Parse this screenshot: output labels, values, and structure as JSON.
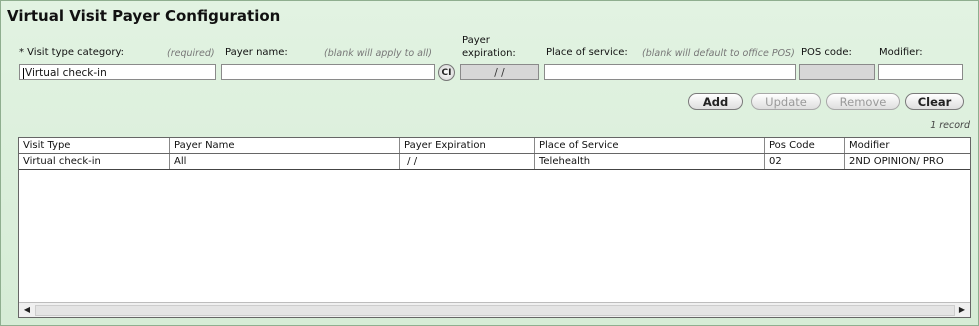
{
  "title": "Virtual Visit Payer Configuration",
  "form": {
    "visit_type_label": "* Visit type category:",
    "visit_type_hint": "(required)",
    "visit_type_value": "Virtual check-in",
    "payer_name_label": "Payer name:",
    "payer_name_hint": "(blank will apply to all)",
    "payer_name_value": "",
    "ci_label": "CI",
    "payer_expiration_label_line1": "Payer",
    "payer_expiration_label_line2": "expiration:",
    "payer_expiration_value": "/ /",
    "place_of_service_label": "Place of service:",
    "place_of_service_hint": "(blank will default to office POS)",
    "place_of_service_value": "",
    "pos_code_label": "POS code:",
    "pos_code_value": "",
    "modifier_label": "Modifier:",
    "modifier_value": ""
  },
  "buttons": {
    "add": "Add",
    "update": "Update",
    "remove": "Remove",
    "clear": "Clear"
  },
  "record_count": "1 record",
  "table": {
    "columns": [
      "Visit Type",
      "Payer Name",
      "Payer Expiration",
      "Place of Service",
      "Pos Code",
      "Modifier"
    ],
    "rows": [
      [
        "Virtual check-in",
        "All",
        " / /",
        "Telehealth",
        "02",
        "2ND OPINION/ PRO"
      ]
    ]
  },
  "scrollbar": {
    "left_arrow": "◀",
    "right_arrow": "▶"
  }
}
